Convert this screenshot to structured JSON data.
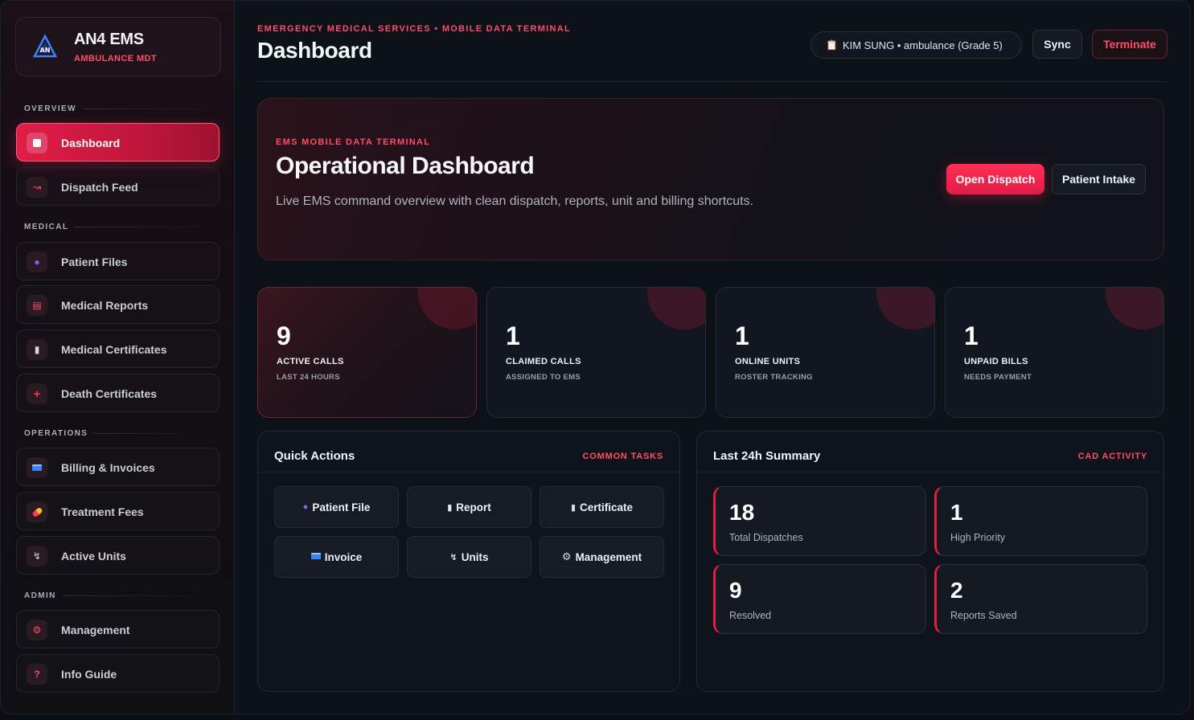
{
  "brand": {
    "title": "AN4 EMS",
    "subtitle": "AMBULANCE MDT"
  },
  "sidebar": {
    "sections": [
      {
        "label": "OVERVIEW"
      },
      {
        "label": "MEDICAL"
      },
      {
        "label": "OPERATIONS"
      },
      {
        "label": "ADMIN"
      }
    ],
    "items": [
      {
        "label": "Dashboard",
        "icon": "dashboard-icon"
      },
      {
        "label": "Dispatch Feed",
        "icon": "satellite-icon"
      },
      {
        "label": "Patient Files",
        "icon": "person-icon"
      },
      {
        "label": "Medical Reports",
        "icon": "report-icon"
      },
      {
        "label": "Medical Certificates",
        "icon": "certificate-icon"
      },
      {
        "label": "Death Certificates",
        "icon": "cross-icon"
      },
      {
        "label": "Billing & Invoices",
        "icon": "card-icon"
      },
      {
        "label": "Treatment Fees",
        "icon": "pill-icon"
      },
      {
        "label": "Active Units",
        "icon": "units-icon"
      },
      {
        "label": "Management",
        "icon": "gear-icon"
      },
      {
        "label": "Info Guide",
        "icon": "question-icon"
      }
    ]
  },
  "header": {
    "eyebrow": "EMERGENCY MEDICAL SERVICES • MOBILE DATA TERMINAL",
    "title": "Dashboard",
    "user": "KIM SUNG • ambulance (Grade 5)",
    "sync_label": "Sync",
    "terminate_label": "Terminate"
  },
  "hero": {
    "eyebrow": "EMS MOBILE DATA TERMINAL",
    "title": "Operational Dashboard",
    "description": "Live EMS command overview with clean dispatch, reports, unit and billing shortcuts.",
    "primary_label": "Open Dispatch",
    "secondary_label": "Patient Intake"
  },
  "stats": [
    {
      "value": "9",
      "label": "ACTIVE CALLS",
      "sub": "LAST 24 HOURS"
    },
    {
      "value": "1",
      "label": "CLAIMED CALLS",
      "sub": "ASSIGNED TO EMS"
    },
    {
      "value": "1",
      "label": "ONLINE UNITS",
      "sub": "ROSTER TRACKING"
    },
    {
      "value": "1",
      "label": "UNPAID BILLS",
      "sub": "NEEDS PAYMENT"
    }
  ],
  "quick_actions": {
    "title": "Quick Actions",
    "tag": "COMMON TASKS",
    "buttons": [
      {
        "label": "Patient File",
        "icon": "person-icon"
      },
      {
        "label": "Report",
        "icon": "document-icon"
      },
      {
        "label": "Certificate",
        "icon": "certificate-icon"
      },
      {
        "label": "Invoice",
        "icon": "card-icon"
      },
      {
        "label": "Units",
        "icon": "units-icon"
      },
      {
        "label": "Management",
        "icon": "gear-icon"
      }
    ]
  },
  "summary": {
    "title": "Last 24h Summary",
    "tag": "CAD ACTIVITY",
    "cards": [
      {
        "value": "18",
        "label": "Total Dispatches"
      },
      {
        "value": "1",
        "label": "High Priority"
      },
      {
        "value": "9",
        "label": "Resolved"
      },
      {
        "value": "2",
        "label": "Reports Saved"
      }
    ]
  },
  "colors": {
    "accent": "#e11d48",
    "accent_text": "#ff4d6a",
    "background": "#0d1118"
  }
}
